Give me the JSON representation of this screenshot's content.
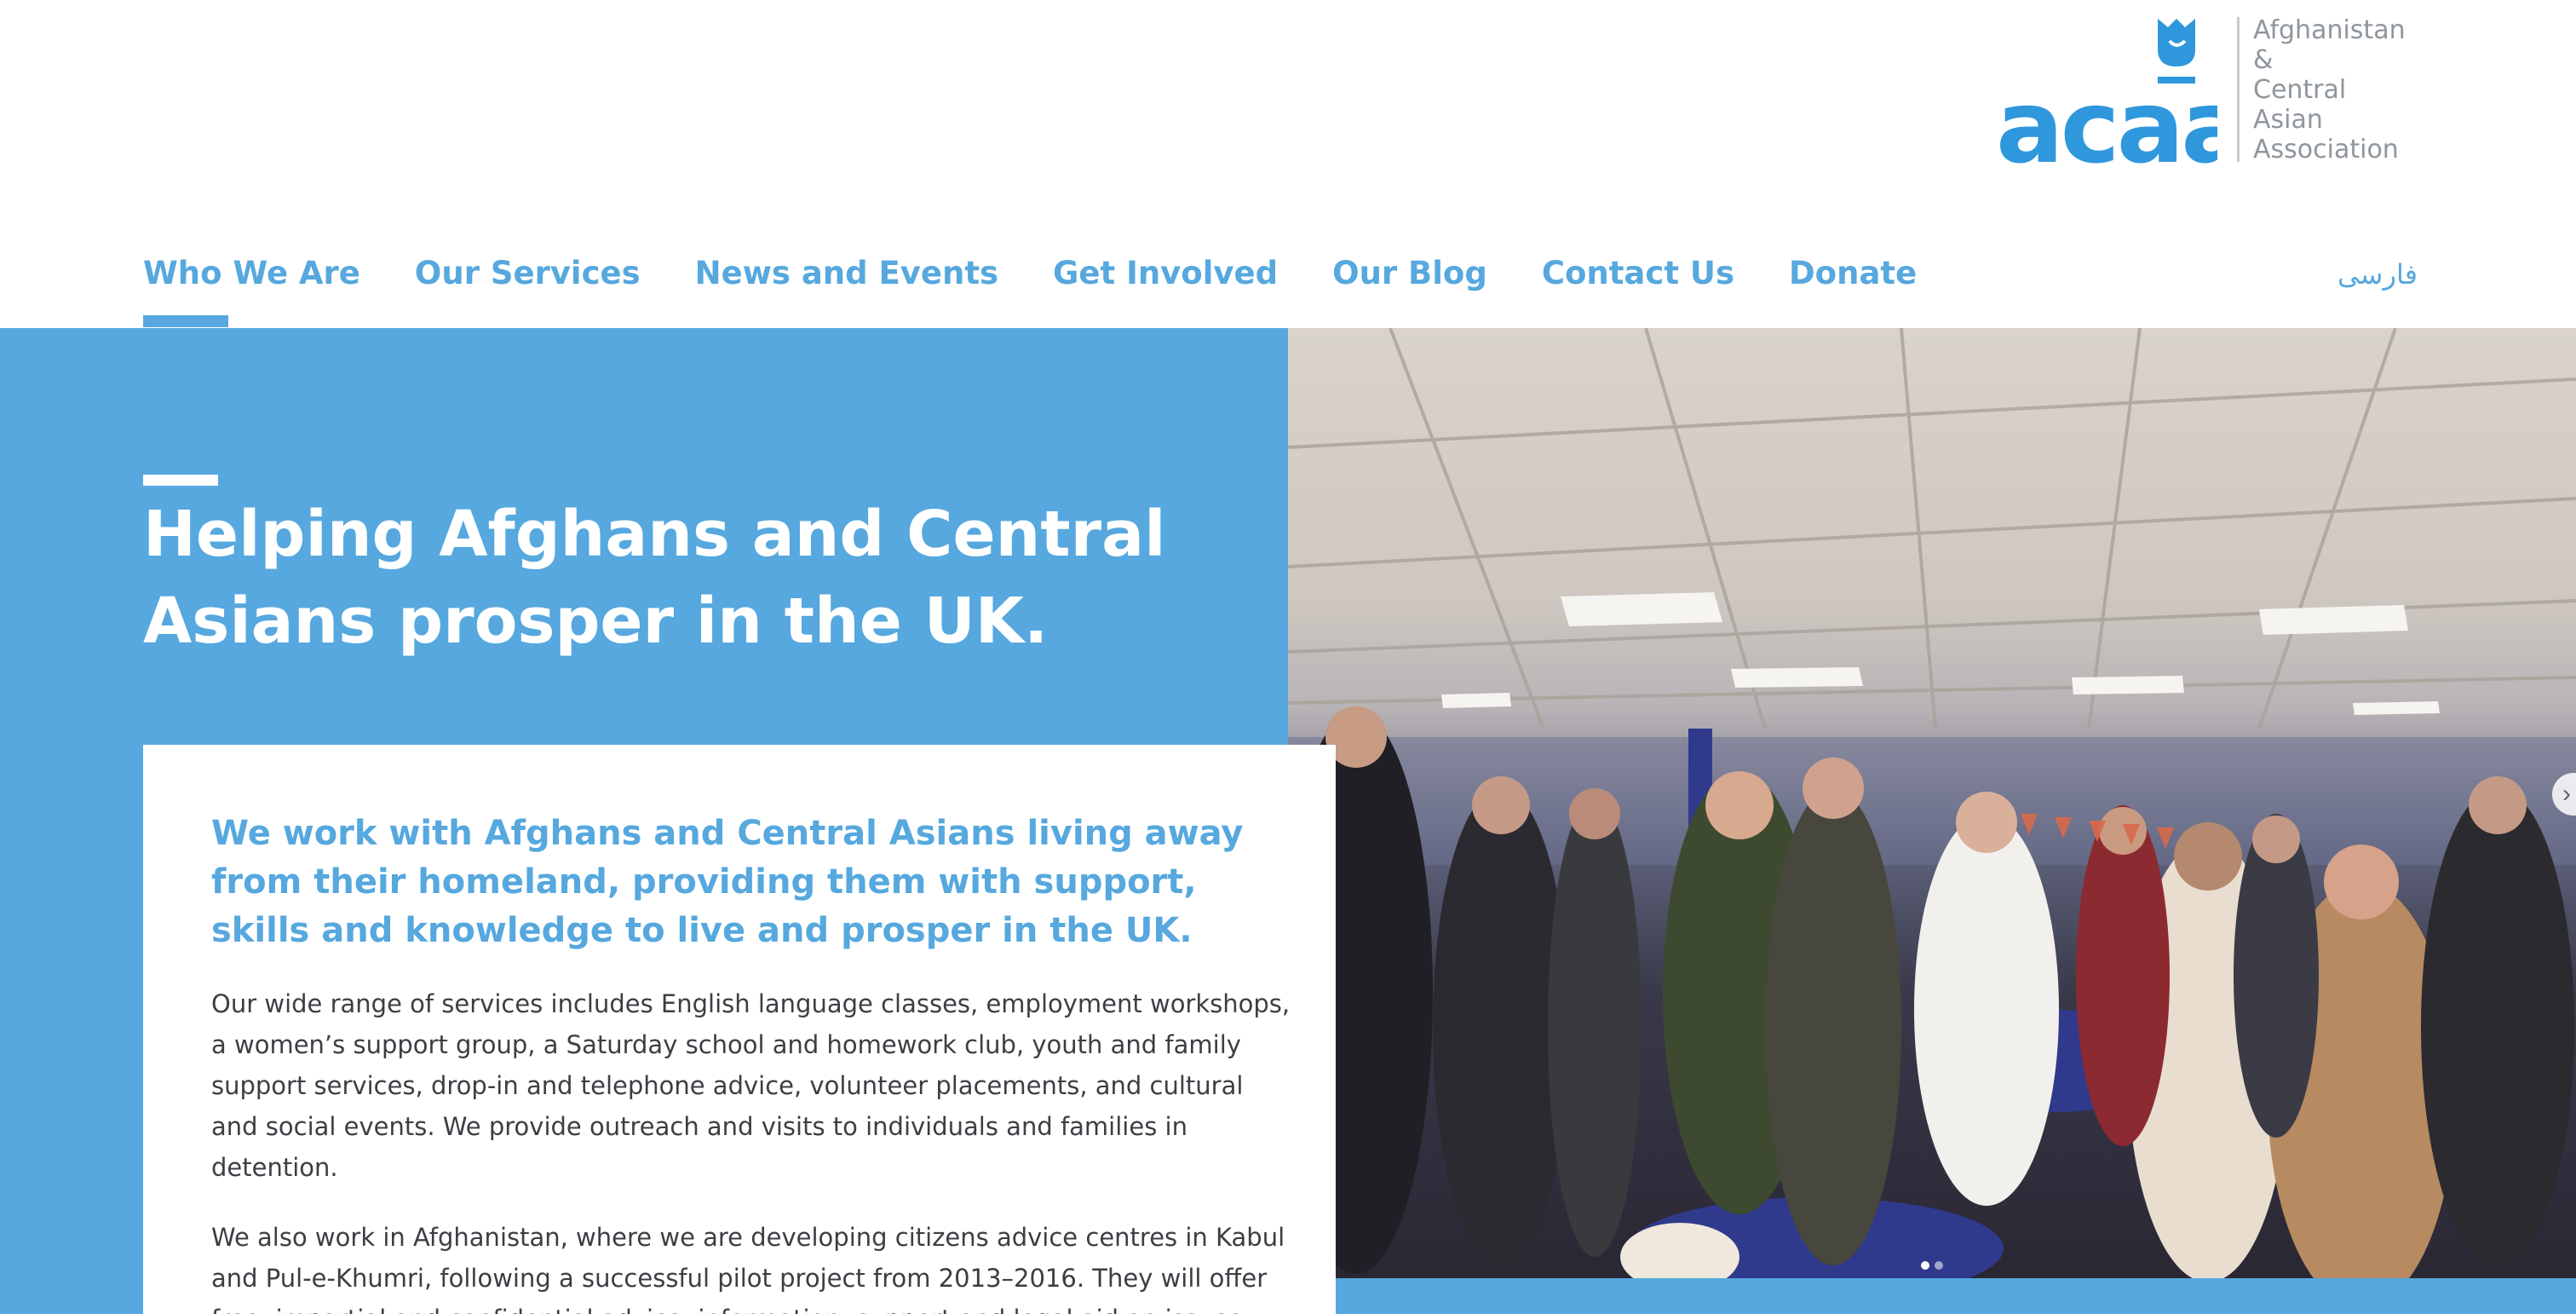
{
  "logo": {
    "wordmark": "acaa",
    "text_lines": [
      "Afghanistan",
      "&",
      "Central",
      "Asian",
      "Association"
    ],
    "colors": {
      "brand_blue": "#2f97dc",
      "text_grey": "#8f969c"
    }
  },
  "nav": {
    "items": [
      {
        "label": "Who We Are",
        "active": true
      },
      {
        "label": "Our Services"
      },
      {
        "label": "News and Events"
      },
      {
        "label": "Get Involved"
      },
      {
        "label": "Our Blog"
      },
      {
        "label": "Contact Us"
      },
      {
        "label": "Donate"
      }
    ],
    "language_link": "فارسی"
  },
  "hero": {
    "title": "Helping Afghans and Central Asians prosper in the UK.",
    "image_description_icon": "community-photo-icon",
    "carousel": {
      "slides": 2,
      "active_index": 0
    },
    "next_icon": "›"
  },
  "intro": {
    "lead": "We work with Afghans and Central Asians living away from their homeland, providing them with support, skills and knowledge to live and prosper in the UK.",
    "paragraph1": "Our wide range of services includes English language classes, employment workshops, a women’s support group, a Saturday school and homework club, youth and family support services, drop-in and telephone advice, volunteer placements, and cultural and social events. We provide outreach and visits to individuals and families in detention.",
    "paragraph2": "We also work in Afghanistan, where we are developing citizens advice centres in Kabul and Pul-e-Khumri, following a successful pilot project from 2013–2016. They will offer free, impartial and confidential advice, information, support and legal aid on issues"
  },
  "colors": {
    "accent_blue": "#56a8de",
    "body_text": "#3b3f44",
    "background": "#ffffff"
  }
}
